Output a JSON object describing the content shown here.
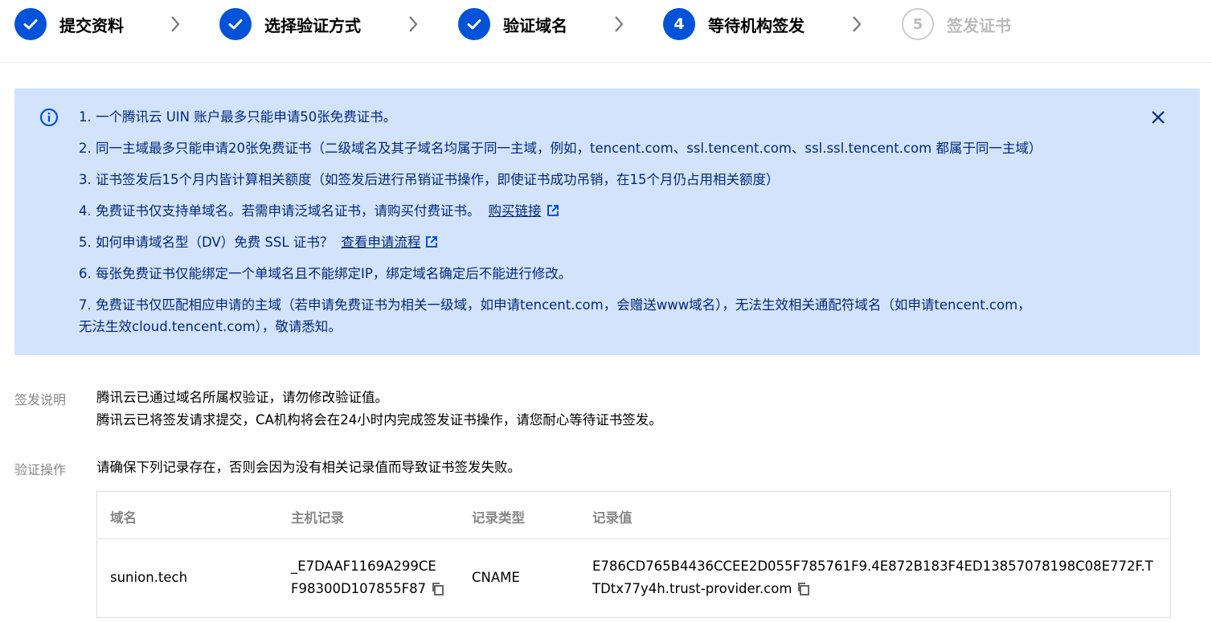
{
  "steps": [
    {
      "label": "提交资料",
      "state": "done"
    },
    {
      "label": "选择验证方式",
      "state": "done"
    },
    {
      "label": "验证域名",
      "state": "done"
    },
    {
      "number": "4",
      "label": "等待机构签发",
      "state": "active"
    },
    {
      "number": "5",
      "label": "签发证书",
      "state": "pending"
    }
  ],
  "notice": {
    "items": [
      "1. 一个腾讯云 UIN 账户最多只能申请50张免费证书。",
      "2. 同一主域最多只能申请20张免费证书（二级域名及其子域名均属于同一主域，例如，tencent.com、ssl.tencent.com、ssl.ssl.tencent.com 都属于同一主域）",
      "3. 证书签发后15个月内皆计算相关额度（如签发后进行吊销证书操作，即使证书成功吊销，在15个月仍占用相关额度）",
      "4. 免费证书仅支持单域名。若需申请泛域名证书，请购买付费证书。",
      "5. 如何申请域名型（DV）免费 SSL 证书？",
      "6. 每张免费证书仅能绑定一个单域名且不能绑定IP，绑定域名确定后不能进行修改。",
      "7. 免费证书仅匹配相应申请的主域（若申请免费证书为相关一级域，如申请tencent.com，会赠送www域名），无法生效相关通配符域名（如申请tencent.com，",
      "无法生效cloud.tencent.com），敬请悉知。"
    ],
    "buy_link": "购买链接",
    "process_link": "查看申请流程"
  },
  "issue": {
    "label": "签发说明",
    "line1": "腾讯云已通过域名所属权验证，请勿修改验证值。",
    "line2": "腾讯云已将签发请求提交，CA机构将会在24小时内完成签发证书操作，请您耐心等待证书签发。"
  },
  "verify": {
    "label": "验证操作",
    "text": "请确保下列记录存在，否则会因为没有相关记录值而导致证书签发失败。"
  },
  "table": {
    "headers": [
      "域名",
      "主机记录",
      "记录类型",
      "记录值"
    ],
    "row": {
      "domain": "sunion.tech",
      "host_line1": "_E7DAAF1169A299CE",
      "host_line2": "F98300D107855F87",
      "type": "CNAME",
      "value_line1": "E786CD765B4436CCEE2D055F785761F9.4E872B183F4ED13857078198C08E772F.T",
      "value_line2": "TDtx77y4h.trust-provider.com"
    }
  },
  "colors": {
    "primary": "#0052d9",
    "notice_bg": "#d4e3fc",
    "notice_text": "#002a7c"
  }
}
